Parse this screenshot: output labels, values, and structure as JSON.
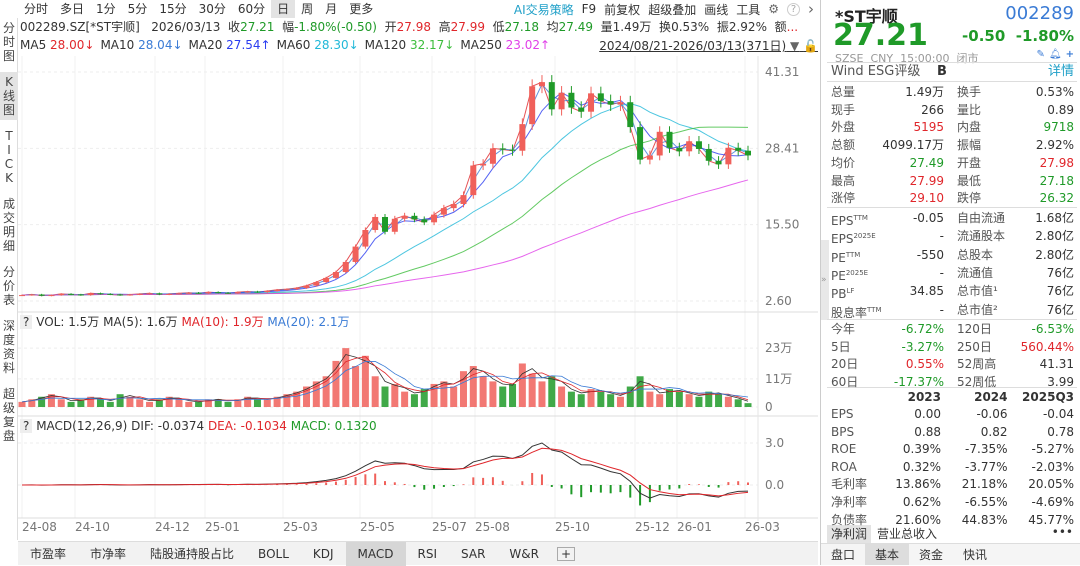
{
  "toolbar": {
    "periods": [
      "分时",
      "多日",
      "1分",
      "5分",
      "15分",
      "30分",
      "60分",
      "日",
      "周",
      "月",
      "更多"
    ],
    "active_period": "日",
    "tools": [
      "AI交易策略",
      "F9",
      "前复权",
      "超级叠加",
      "画线",
      "工具"
    ],
    "icons": [
      "gear-icon",
      "help-icon",
      "chevron-right-icon"
    ]
  },
  "left_tabs": [
    "分时图",
    "K线图",
    "TICK",
    "成交明细",
    "分价表",
    "深度资料",
    "超级复盘"
  ],
  "active_left_tab": "K线图",
  "info": {
    "code": "002289.SZ[*ST宇顺]",
    "date": "2026/03/13",
    "close_label": "收",
    "close": "27.21",
    "chg_label": "幅",
    "chg": "-1.80%(-0.50)",
    "open_label": "开",
    "open": "27.98",
    "high_label": "高",
    "high": "27.99",
    "low_label": "低",
    "low": "27.18",
    "avg_label": "均",
    "avg": "27.49",
    "vol_label": "量",
    "vol": "1.49万",
    "turn_label": "换",
    "turn": "0.53%",
    "amp_label": "振",
    "amp": "2.92%",
    "amt_label": "额",
    "amt": "..."
  },
  "ma": [
    {
      "label": "MA5",
      "value": "28.00↓",
      "color": "#e0262b"
    },
    {
      "label": "MA10",
      "value": "28.04↓",
      "color": "#3a7bd5"
    },
    {
      "label": "MA20",
      "value": "27.54↑",
      "color": "#2a3cf0"
    },
    {
      "label": "MA60",
      "value": "28.30↓",
      "color": "#20b8d8"
    },
    {
      "label": "MA120",
      "value": "32.17↓",
      "color": "#3cbd3c"
    },
    {
      "label": "MA250",
      "value": "23.02↑",
      "color": "#e040e8"
    }
  ],
  "date_range": "2024/08/21-2026/03/13(371日)",
  "vol_header": {
    "q": "?",
    "vol": "VOL: 1.5万",
    "ma5": "MA(5): 1.6万",
    "ma10": "MA(10): 1.9万",
    "ma20": "MA(20): 2.1万"
  },
  "macd_header": {
    "q": "?",
    "name": "MACD(12,26,9)",
    "dif": "DIF: -0.0374",
    "dea": "DEA: -0.1034",
    "macd": "MACD: 0.1320"
  },
  "chart_data": {
    "type": "candlestick",
    "price_axis_ticks": [
      "41.31",
      "28.41",
      "15.50",
      "2.60"
    ],
    "ylim": [
      2.6,
      41.31
    ],
    "x_tick_labels": [
      "24-08",
      "24-10",
      "24-12",
      "25-01",
      "25-03",
      "25-05",
      "25-07",
      "25-08",
      "25-10",
      "25-12",
      "26-01",
      "26-03"
    ],
    "closes": [
      3.6,
      3.7,
      3.5,
      3.6,
      3.8,
      3.7,
      3.6,
      3.9,
      3.8,
      3.7,
      3.6,
      3.7,
      3.8,
      3.9,
      3.7,
      3.8,
      3.9,
      4.0,
      3.9,
      4.1,
      4.0,
      3.9,
      4.1,
      4.2,
      4.1,
      4.3,
      4.5,
      4.6,
      4.8,
      5.2,
      5.8,
      6.5,
      7.5,
      9.2,
      11.8,
      14.6,
      16.8,
      14.3,
      16.5,
      17.0,
      16.4,
      15.9,
      17.2,
      18.3,
      19.0,
      20.5,
      25.5,
      25.8,
      28.4,
      28.2,
      28.0,
      32.5,
      38.9,
      39.6,
      35.0,
      37.8,
      35.3,
      34.6,
      37.7,
      36.4,
      35.8,
      36.2,
      32.0,
      26.5,
      27.2,
      31.2,
      28.5,
      27.9,
      29.6,
      28.3,
      26.3,
      25.7,
      28.5,
      28.0,
      27.21
    ],
    "volume_axis_ticks": [
      "23万",
      "11万",
      "0"
    ],
    "volume_ylim": [
      0,
      25
    ],
    "volumes": [
      2,
      3,
      4,
      5,
      3,
      2,
      3,
      4,
      3,
      2,
      5,
      4,
      3,
      2,
      3,
      4,
      3,
      2,
      2,
      3,
      3,
      2,
      3,
      4,
      3,
      3,
      4,
      5,
      6,
      8,
      10,
      12,
      18,
      23,
      16,
      20,
      12,
      8,
      9,
      6,
      5,
      7,
      9,
      10,
      8,
      14,
      16,
      12,
      10,
      8,
      9,
      17,
      13,
      10,
      12,
      8,
      6,
      5,
      7,
      6,
      5,
      4,
      8,
      12,
      6,
      5,
      7,
      6,
      5,
      4,
      6,
      5,
      4,
      3,
      1.5
    ],
    "macd_axis_ticks": [
      "3.0",
      "0.0"
    ],
    "up_color": "#f0605a",
    "down_color": "#1f9a28"
  },
  "bottom_tabs": [
    "市盈率",
    "市净率",
    "陆股通持股占比",
    "BOLL",
    "KDJ",
    "MACD",
    "RSI",
    "SAR",
    "W&R",
    "+"
  ],
  "active_bottom_tab": "MACD",
  "quote": {
    "name": "*ST宇顺",
    "code": "002289",
    "price": "27.21",
    "change": "-0.50",
    "pct": "-1.80%",
    "exchange": "SZSE",
    "currency": "CNY",
    "time": "15:00:00",
    "status": "闭市",
    "esg_label": "Wind ESG评级",
    "esg": "B",
    "detail": "详情"
  },
  "stats": [
    [
      "总量",
      "1.49万",
      "",
      "换手",
      "0.53%",
      ""
    ],
    [
      "现手",
      "266",
      "",
      "量比",
      "0.89",
      ""
    ],
    [
      "外盘",
      "5195",
      "r",
      "内盘",
      "9718",
      "g"
    ],
    [
      "总额",
      "4099.17万",
      "",
      "振幅",
      "2.92%",
      ""
    ],
    [
      "均价",
      "27.49",
      "g",
      "开盘",
      "27.98",
      "r"
    ],
    [
      "最高",
      "27.99",
      "r",
      "最低",
      "27.18",
      "g"
    ],
    [
      "涨停",
      "29.10",
      "r",
      "跌停",
      "26.32",
      "g"
    ]
  ],
  "valuation": [
    [
      "EPS",
      "TTM",
      "-0.05",
      "自由流通",
      "1.68亿"
    ],
    [
      "EPS",
      "2025E",
      "-",
      "流通股本",
      "2.80亿"
    ],
    [
      "PE",
      "TTM",
      "-550",
      "总股本",
      "2.80亿"
    ],
    [
      "PE",
      "2025E",
      "-",
      "流通值",
      "76亿"
    ],
    [
      "PB",
      "LF",
      "34.85",
      "总市值¹",
      "76亿"
    ],
    [
      "股息率",
      "TTM",
      "-",
      "总市值²",
      "76亿"
    ]
  ],
  "returns": [
    [
      "今年",
      "-6.72%",
      "g",
      "120日",
      "-6.53%",
      "g"
    ],
    [
      "5日",
      "-3.27%",
      "g",
      "250日",
      "560.44%",
      "r"
    ],
    [
      "20日",
      "0.55%",
      "r",
      "52周高",
      "41.31",
      ""
    ],
    [
      "60日",
      "-17.37%",
      "g",
      "52周低",
      "3.99",
      ""
    ]
  ],
  "fin_header": [
    "2023",
    "2024",
    "2025Q3"
  ],
  "fin": [
    [
      "EPS",
      "0.00",
      "-0.06",
      "-0.04"
    ],
    [
      "BPS",
      "0.88",
      "0.82",
      "0.78"
    ],
    [
      "ROE",
      "0.39%",
      "-7.35%",
      "-5.27%"
    ],
    [
      "ROA",
      "0.32%",
      "-3.77%",
      "-2.03%"
    ],
    [
      "毛利率",
      "13.86%",
      "21.18%",
      "20.05%"
    ],
    [
      "净利率",
      "0.62%",
      "-6.55%",
      "-4.69%"
    ],
    [
      "负债率",
      "21.60%",
      "44.83%",
      "45.77%"
    ]
  ],
  "fin_tabs": [
    "净利润",
    "营业总收入"
  ],
  "more": "•••",
  "panel_tabs": [
    "盘口",
    "基本",
    "资金",
    "快讯"
  ],
  "active_panel_tab": "基本"
}
